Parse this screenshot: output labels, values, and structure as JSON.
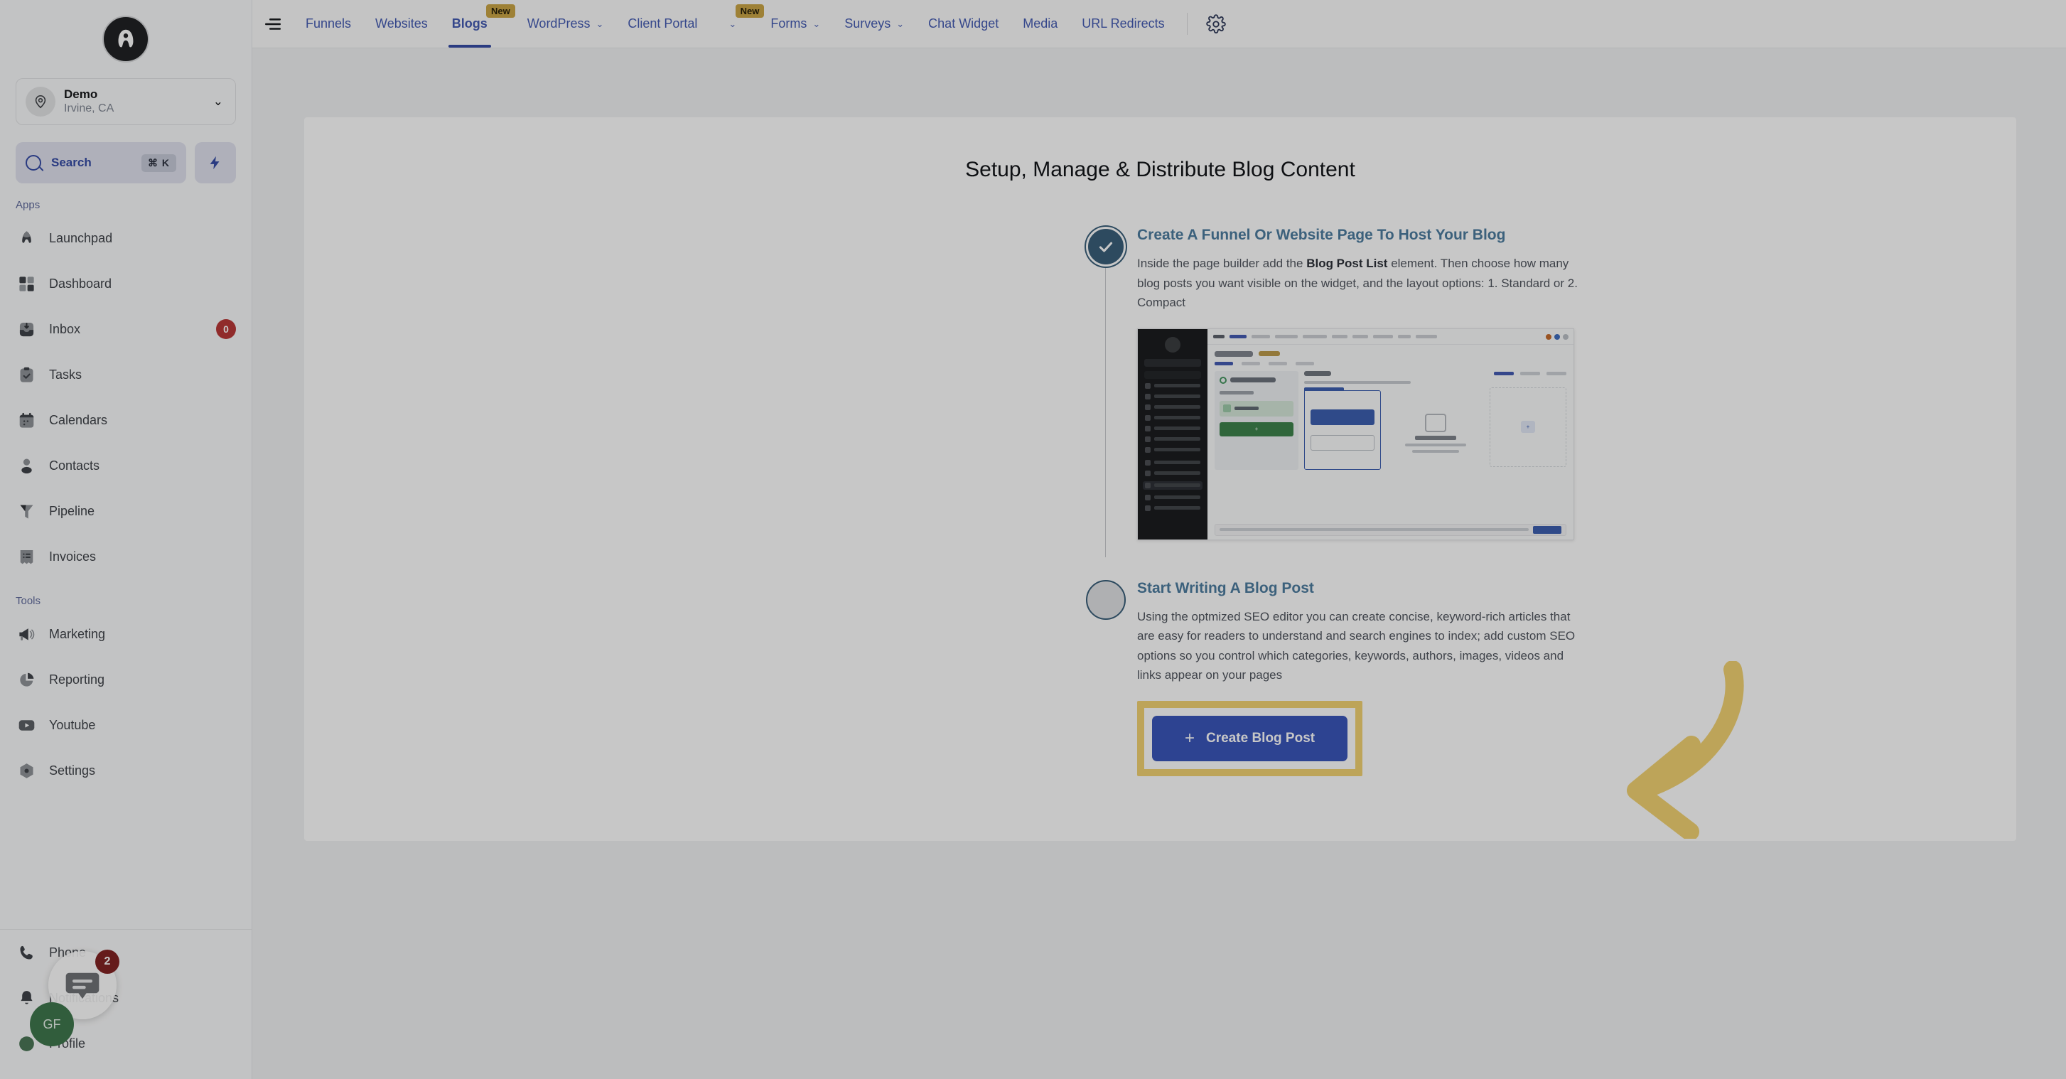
{
  "sidebar": {
    "logo_name": "agency-logo",
    "location": {
      "name": "Demo",
      "sub": "Irvine, CA",
      "chevron": "⌄"
    },
    "search": {
      "label": "Search",
      "shortcut": "⌘ K"
    },
    "quick_action_icon": "bolt-icon",
    "groups": [
      {
        "label": "Apps",
        "items": [
          {
            "label": "Launchpad",
            "icon": "rocket-icon",
            "badge": ""
          },
          {
            "label": "Dashboard",
            "icon": "grid-icon",
            "badge": ""
          },
          {
            "label": "Inbox",
            "icon": "inbox-icon",
            "badge": "0"
          },
          {
            "label": "Tasks",
            "icon": "clipboard-check-icon",
            "badge": ""
          },
          {
            "label": "Calendars",
            "icon": "calendar-icon",
            "badge": ""
          },
          {
            "label": "Contacts",
            "icon": "person-icon",
            "badge": ""
          },
          {
            "label": "Pipeline",
            "icon": "funnel-icon",
            "badge": ""
          },
          {
            "label": "Invoices",
            "icon": "invoice-icon",
            "badge": ""
          }
        ]
      },
      {
        "label": "Tools",
        "items": [
          {
            "label": "Marketing",
            "icon": "megaphone-icon",
            "badge": ""
          },
          {
            "label": "Reporting",
            "icon": "pie-chart-icon",
            "badge": ""
          },
          {
            "label": "Youtube",
            "icon": "youtube-icon",
            "badge": ""
          },
          {
            "label": "Settings",
            "icon": "gear-icon",
            "badge": ""
          }
        ]
      }
    ],
    "footer_items": [
      {
        "label": "Phone",
        "icon": "phone-icon"
      },
      {
        "label": "Notifications",
        "icon": "bell-icon"
      },
      {
        "label": "Profile",
        "icon": "profile-icon"
      }
    ]
  },
  "topbar": {
    "collapse_icon": "collapse-sidebar-icon",
    "tabs": [
      {
        "label": "Funnels",
        "caret": false,
        "badge": "",
        "active": false
      },
      {
        "label": "Websites",
        "caret": false,
        "badge": "",
        "active": false
      },
      {
        "label": "Blogs",
        "caret": false,
        "badge": "New",
        "active": true
      },
      {
        "label": "WordPress",
        "caret": true,
        "badge": "",
        "active": false
      },
      {
        "label": "Client Portal",
        "caret": true,
        "badge": "New",
        "active": false
      },
      {
        "label": "Forms",
        "caret": true,
        "badge": "",
        "active": false
      },
      {
        "label": "Surveys",
        "caret": true,
        "badge": "",
        "active": false
      },
      {
        "label": "Chat Widget",
        "caret": false,
        "badge": "",
        "active": false
      },
      {
        "label": "Media",
        "caret": false,
        "badge": "",
        "active": false
      },
      {
        "label": "URL Redirects",
        "caret": false,
        "badge": "",
        "active": false
      }
    ],
    "settings_icon": "gear-icon",
    "caret_glyph": "⌄"
  },
  "main": {
    "title": "Setup, Manage & Distribute Blog Content",
    "steps": [
      {
        "state": "done",
        "title": "Create A Funnel Or Website Page To Host Your Blog",
        "desc_1": "Inside the page builder add the ",
        "desc_bold": "Blog Post List",
        "desc_2": " element. Then choose how many blog posts you want visible on the widget, and the layout options: 1. Standard or 2. Compact",
        "has_thumbnail": true
      },
      {
        "state": "todo",
        "title": "Start Writing A Blog Post",
        "desc_1": "Using the optmized SEO editor you can create concise, keyword-rich articles that are easy for readers to understand and search engines to index; add custom SEO options so you control which categories, keywords, authors, images, videos and links appear on your pages",
        "desc_bold": "",
        "desc_2": "",
        "has_thumbnail": false
      }
    ],
    "cta": {
      "label": "Create Blog Post",
      "plus": "+",
      "highlight_color": "#ffd24d",
      "button_color": "#2f55e0"
    },
    "annotation_arrow": "highlight-arrow-icon"
  },
  "overlay": {
    "chat_badge": "2",
    "chat_icon": "chat-bubble-icon",
    "avatar_initials": "GF"
  },
  "colors": {
    "accent_blue": "#2c4bc7",
    "link_blue": "#3b5bd4",
    "step_blue": "#2d6187",
    "highlight_yellow": "#ffd24d",
    "badge_red": "#e02d2d",
    "new_badge": "#d9a520"
  }
}
